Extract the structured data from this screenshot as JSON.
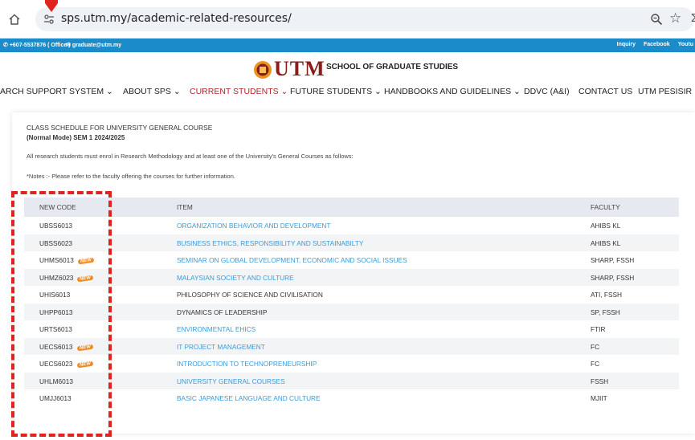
{
  "browser": {
    "url": "sps.utm.my/academic-related-resources/",
    "icons": [
      "home-icon",
      "site-info-icon",
      "zoom-icon",
      "star-icon"
    ],
    "overflow_glyph": "Σ",
    "marker_color": "#e0231e"
  },
  "top_strip": {
    "phone": "+607-5537876 ( Office )",
    "email": "graduate@utm.my",
    "links": [
      "Inquiry",
      "Facebook",
      "Youtu"
    ],
    "color": "#1c8bc9"
  },
  "logo": {
    "word": "UTM",
    "school": "SCHOOL OF GRADUATE STUDIES",
    "color": "#8a1c1c"
  },
  "nav": {
    "items": [
      "ARCH SUPPORT SYSTEM ⌄",
      "ABOUT SPS ⌄",
      "CURRENT STUDENTS ⌄",
      "FUTURE STUDENTS ⌄",
      "HANDBOOKS AND GUIDELINES ⌄",
      "DDVC (A&I)",
      "CONTACT US",
      "UTM PESISIR"
    ],
    "active_color": "#b3252a"
  },
  "content": {
    "title": "CLASS SCHEDULE FOR UNIVERSITY GENERAL COURSE",
    "subtitle": "(Normal Mode) SEM 1 2024/2025",
    "note1": "All research students must enrol in Research Methodology and at least one of the University's General Courses as follows:",
    "note2": "*Notes :- Please refer to the faculty offering the courses for further information."
  },
  "table": {
    "headers": [
      "NEW CODE",
      "ITEM",
      "FACULTY"
    ],
    "new_label": "NEW",
    "rows": [
      {
        "code": "UBSS6013",
        "item": "ORGANIZATION BEHAVIOR AND DEVELOPMENT",
        "faculty": "AHIBS KL"
      },
      {
        "code": "UBSS6023",
        "item": "BUSINESS ETHICS, RESPONSIBILITY AND SUSTAINABILTY",
        "faculty": "AHIBS KL"
      },
      {
        "code": "UHMS6013",
        "item": "SEMINAR ON GLOBAL DEVELOPMENT, ECONOMIC AND SOCIAL ISSUES",
        "faculty": "SHARP, FSSH"
      },
      {
        "code": "UHMZ6023",
        "item": "MALAYSIAN SOCIETY AND CULTURE",
        "faculty": "SHARP, FSSH"
      },
      {
        "code": "UHIS6013",
        "item": "PHILOSOPHY OF SCIENCE AND CIVILISATION",
        "faculty": "ATI, FSSH"
      },
      {
        "code": "UHPP6013",
        "item": "DYNAMICS OF LEADERSHIP",
        "faculty": "SP, FSSH"
      },
      {
        "code": "URTS6013",
        "item": "ENVIRONMENTAL EHICS",
        "faculty": "FTIR"
      },
      {
        "code": "UECS6013",
        "item": "IT PROJECT MANAGEMENT",
        "faculty": "FC"
      },
      {
        "code": "UECS6023",
        "item": "INTRODUCTION TO TECHNOPRENEURSHIP",
        "faculty": "FC"
      },
      {
        "code": "UHLM6013",
        "item": "UNIVERSITY GENERAL COURSES",
        "faculty": "FSSH"
      },
      {
        "code": "UMJJ6013",
        "item": "BASIC JAPANESE LANGUAGE AND CULTURE",
        "faculty": "MJIIT"
      }
    ],
    "link_color": "#3a9bd9",
    "highlight_color": "#e0231e"
  }
}
